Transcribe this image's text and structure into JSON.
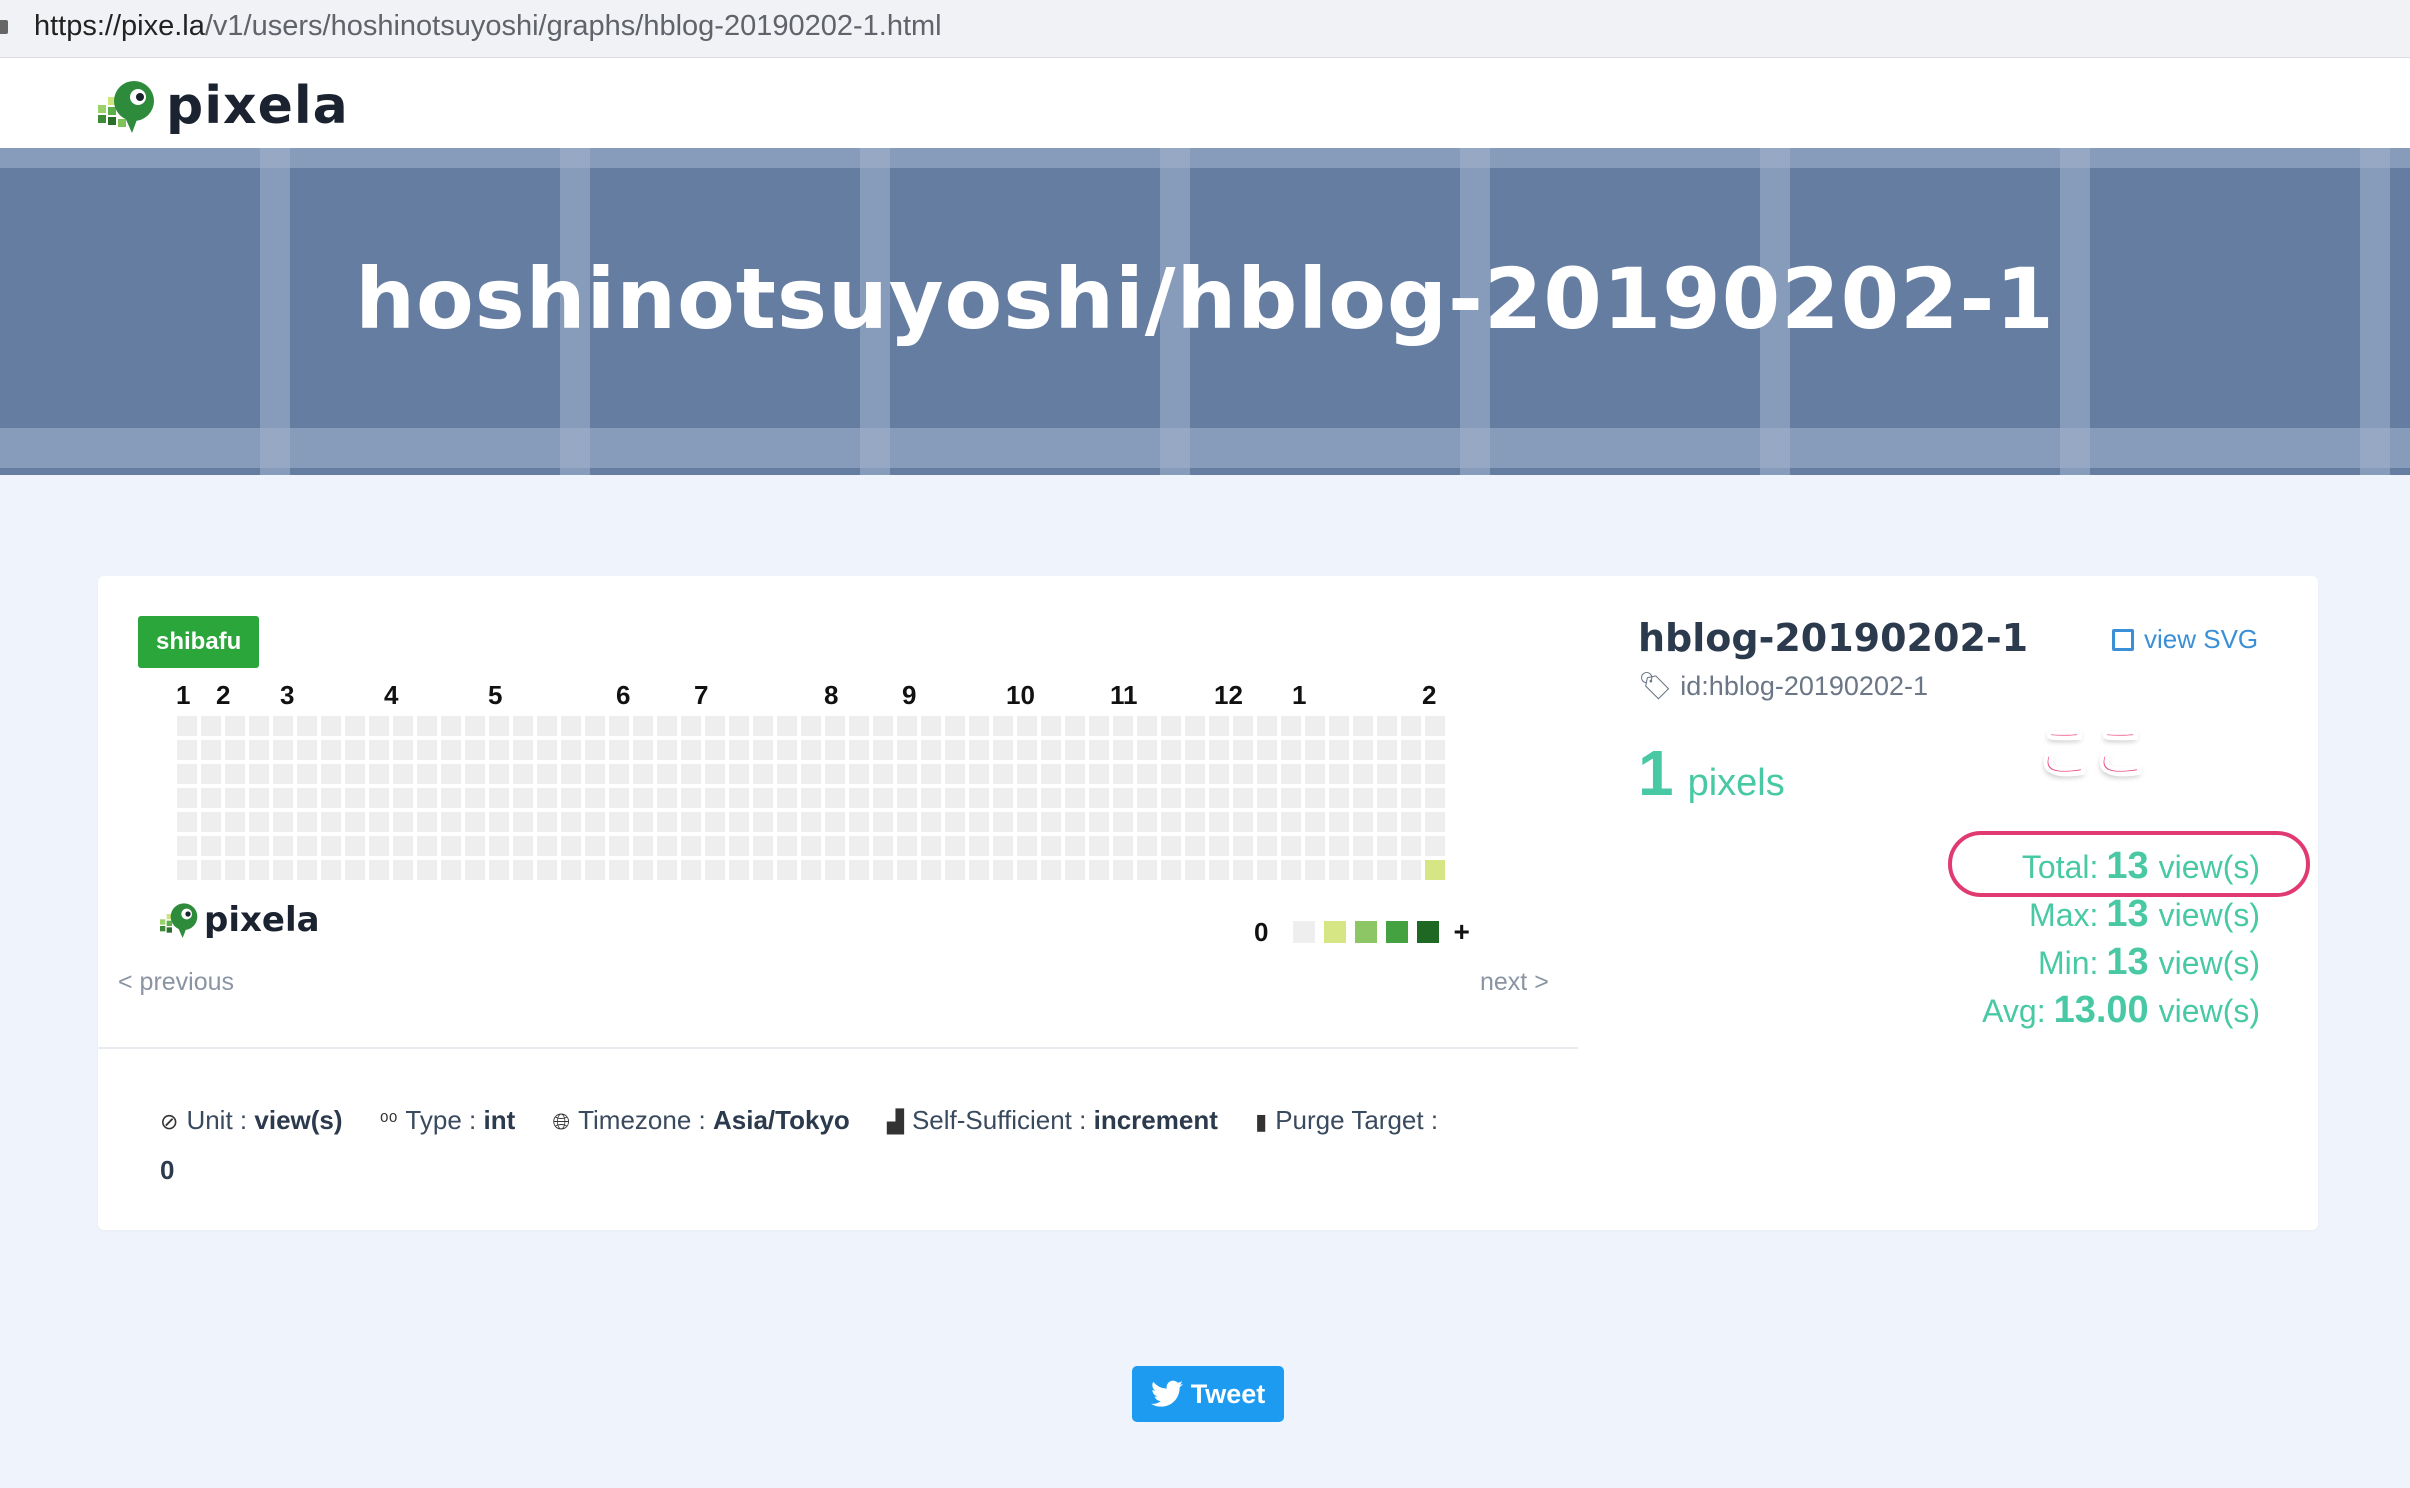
{
  "browser": {
    "url_host": "https://pixe.la",
    "url_path": "/v1/users/hoshinotsuyoshi/graphs/hblog-20190202-1.html"
  },
  "header": {
    "logo_text": "pixela"
  },
  "hero": {
    "title": "hoshinotsuyoshi/hblog-20190202-1"
  },
  "graph": {
    "color_badge": "shibafu",
    "months": [
      "1",
      "2",
      "3",
      "4",
      "5",
      "6",
      "7",
      "8",
      "9",
      "10",
      "11",
      "12",
      "1",
      "2"
    ],
    "weeks": 53,
    "days": 7,
    "active_pixels": [
      {
        "week": 52,
        "day": 6,
        "level": 1
      }
    ],
    "logo_text": "pixela",
    "legend_min": "0",
    "legend_max": "+",
    "legend_colors": [
      "#eeeeee",
      "#d6e685",
      "#8cc665",
      "#44a340",
      "#1e6823"
    ],
    "prev_label": "< previous",
    "next_label": "next >"
  },
  "meta": {
    "unit_label": "Unit",
    "unit_value": "view(s)",
    "type_label": "Type",
    "type_value": "int",
    "timezone_label": "Timezone",
    "timezone_value": "Asia/Tokyo",
    "self_sufficient_label": "Self-Sufficient",
    "self_sufficient_value": "increment",
    "purge_label": "Purge Target",
    "purge_value": "0",
    "sep": ":"
  },
  "info": {
    "name": "hblog-20190202-1",
    "id_text": "id:hblog-20190202-1",
    "view_svg": "view SVG",
    "pixel_count": "1",
    "pixel_unit": "pixels",
    "total_label": "Total:",
    "total_value": "13",
    "max_label": "Max:",
    "max_value": "13",
    "min_label": "Min:",
    "min_value": "13",
    "avg_label": "Avg:",
    "avg_value": "13.00",
    "unit": "view(s)"
  },
  "annotation": {
    "text": "ここ",
    "color": "#e03a70"
  },
  "tweet": {
    "label": "Tweet"
  }
}
